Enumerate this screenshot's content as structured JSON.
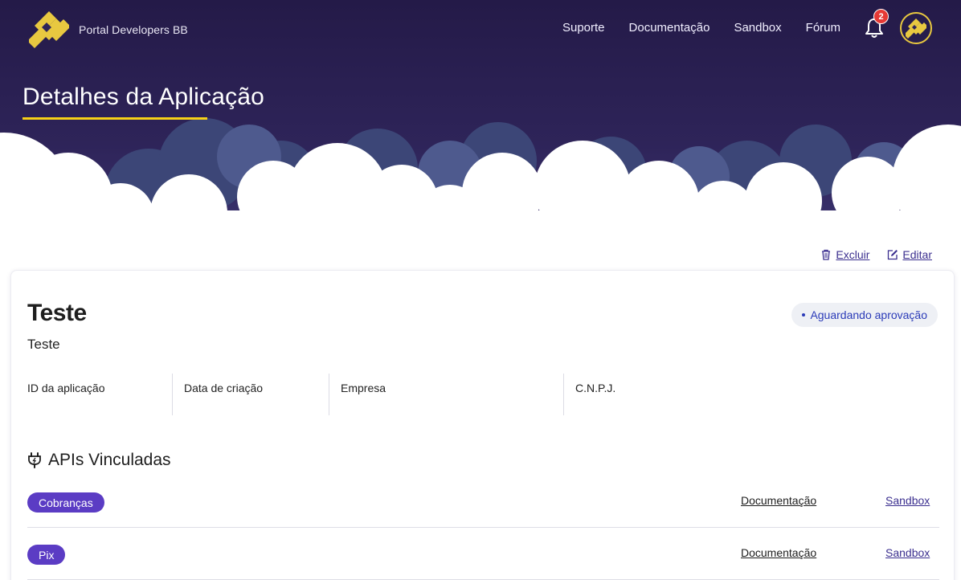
{
  "header": {
    "brand_name": "Portal Developers BB",
    "nav": {
      "suporte": "Suporte",
      "documentacao": "Documentação",
      "sandbox": "Sandbox",
      "forum": "Fórum"
    },
    "notifications_count": "2",
    "page_title": "Detalhes da Aplicação"
  },
  "actions": {
    "delete_label": "Excluir",
    "edit_label": "Editar"
  },
  "app": {
    "name": "Teste",
    "description": "Teste",
    "status": "Aguardando aprovação",
    "fields": {
      "id_label": "ID da aplicação",
      "created_label": "Data de criação",
      "company_label": "Empresa",
      "cnpj_label": "C.N.P.J."
    }
  },
  "apis": {
    "title": "APIs Vinculadas",
    "items": [
      {
        "name": "Cobranças",
        "doc_label": "Documentação",
        "sandbox_label": "Sandbox"
      },
      {
        "name": "Pix",
        "doc_label": "Documentação",
        "sandbox_label": "Sandbox"
      }
    ]
  },
  "colors": {
    "hero_bg": "#2e2459",
    "accent_yellow": "#f7d117",
    "pill_purple": "#5b3cc4",
    "status_blue": "#2b3bb8",
    "notification_red": "#e53935"
  },
  "icons": {
    "brand": "bb-logo-icon",
    "notifications": "bell-icon",
    "avatar": "bb-logo-icon",
    "delete": "trash-icon",
    "edit": "edit-icon",
    "apis": "plug-icon"
  }
}
